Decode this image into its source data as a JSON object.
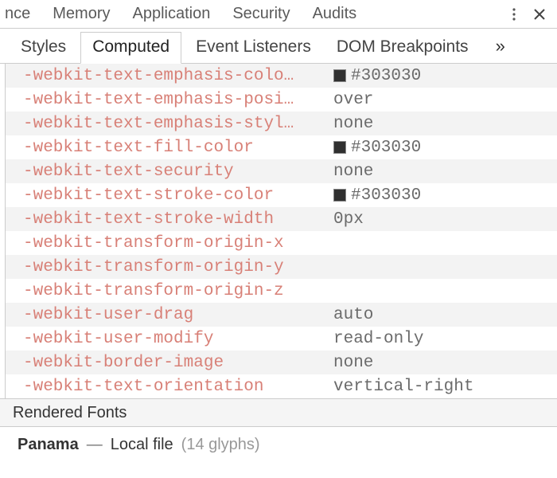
{
  "topbar": {
    "tabs": [
      "nce",
      "Memory",
      "Application",
      "Security",
      "Audits"
    ]
  },
  "subtabs": {
    "items": [
      "Styles",
      "Computed",
      "Event Listeners",
      "DOM Breakpoints"
    ],
    "selected": 1
  },
  "properties": [
    {
      "name": "-webkit-text-emphasis-colo…",
      "value": "#303030",
      "color": "#303030"
    },
    {
      "name": "-webkit-text-emphasis-posi…",
      "value": "over"
    },
    {
      "name": "-webkit-text-emphasis-styl…",
      "value": "none"
    },
    {
      "name": "-webkit-text-fill-color",
      "value": "#303030",
      "color": "#303030"
    },
    {
      "name": "-webkit-text-security",
      "value": "none"
    },
    {
      "name": "-webkit-text-stroke-color",
      "value": "#303030",
      "color": "#303030"
    },
    {
      "name": "-webkit-text-stroke-width",
      "value": "0px"
    },
    {
      "name": "-webkit-transform-origin-x",
      "value": ""
    },
    {
      "name": "-webkit-transform-origin-y",
      "value": ""
    },
    {
      "name": "-webkit-transform-origin-z",
      "value": ""
    },
    {
      "name": "-webkit-user-drag",
      "value": "auto"
    },
    {
      "name": "-webkit-user-modify",
      "value": "read-only"
    },
    {
      "name": "-webkit-border-image",
      "value": "none"
    },
    {
      "name": "-webkit-text-orientation",
      "value": "vertical-right"
    }
  ],
  "rendered_fonts": {
    "header": "Rendered Fonts",
    "font_name": "Panama",
    "source": "Local file",
    "glyphs": "(14 glyphs)"
  }
}
